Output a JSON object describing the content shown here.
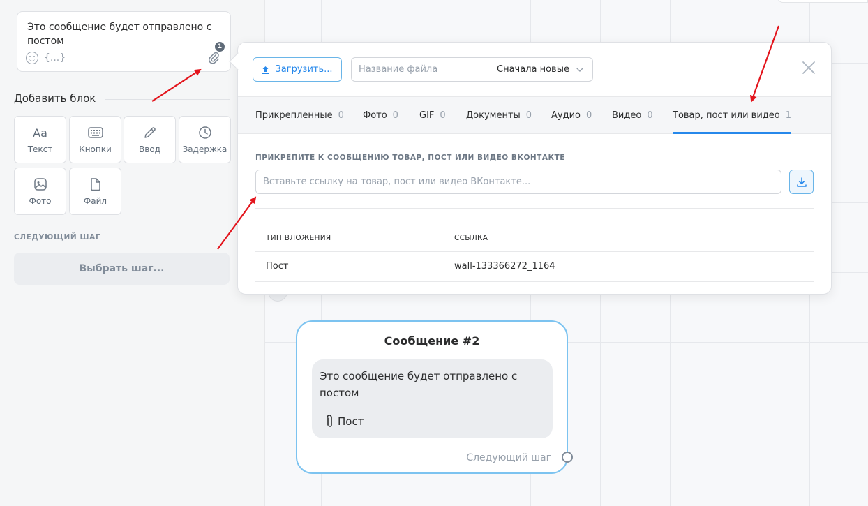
{
  "editor": {
    "message_text": "Это сообщение будет отправлено с постом",
    "vars_label": "{...}",
    "attachment_count": "1"
  },
  "add_block": {
    "title": "Добавить блок",
    "items": [
      {
        "label": "Текст",
        "icon": "text-icon",
        "glyph": "Aa"
      },
      {
        "label": "Кнопки",
        "icon": "keyboard-icon"
      },
      {
        "label": "Ввод",
        "icon": "pencil-icon"
      },
      {
        "label": "Задержка",
        "icon": "clock-icon"
      },
      {
        "label": "Фото",
        "icon": "image-icon"
      },
      {
        "label": "Файл",
        "icon": "file-icon"
      }
    ]
  },
  "next_step": {
    "title": "СЛЕДУЮЩИЙ ШАГ",
    "button_label": "Выбрать шаг..."
  },
  "modal": {
    "upload_label": "Загрузить...",
    "filename_placeholder": "Название файла",
    "sort_value": "Сначала новые",
    "tabs": [
      {
        "label": "Прикрепленные",
        "count": "0"
      },
      {
        "label": "Фото",
        "count": "0"
      },
      {
        "label": "GIF",
        "count": "0"
      },
      {
        "label": "Документы",
        "count": "0"
      },
      {
        "label": "Аудио",
        "count": "0"
      },
      {
        "label": "Видео",
        "count": "0"
      },
      {
        "label": "Товар, пост или видео",
        "count": "1",
        "active": true
      }
    ],
    "attach_title": "ПРИКРЕПИТЕ К СООБЩЕНИЮ ТОВАР, ПОСТ ИЛИ ВИДЕО ВКОНТАКТЕ",
    "link_placeholder": "Вставьте ссылку на товар, пост или видео ВКонтакте...",
    "table": {
      "headers": [
        "ТИП ВЛОЖЕНИЯ",
        "ССЫЛКА"
      ],
      "rows": [
        [
          "Пост",
          "wall-133366272_1164"
        ]
      ]
    }
  },
  "node": {
    "title": "Сообщение #2",
    "text": "Это сообщение будет отправлено с постом",
    "attachment_label": "Пост",
    "next_label": "Следующий шаг"
  },
  "colors": {
    "accent": "#2688eb",
    "node_border": "#7cc3f0",
    "annotation_arrow": "#e3141c"
  }
}
